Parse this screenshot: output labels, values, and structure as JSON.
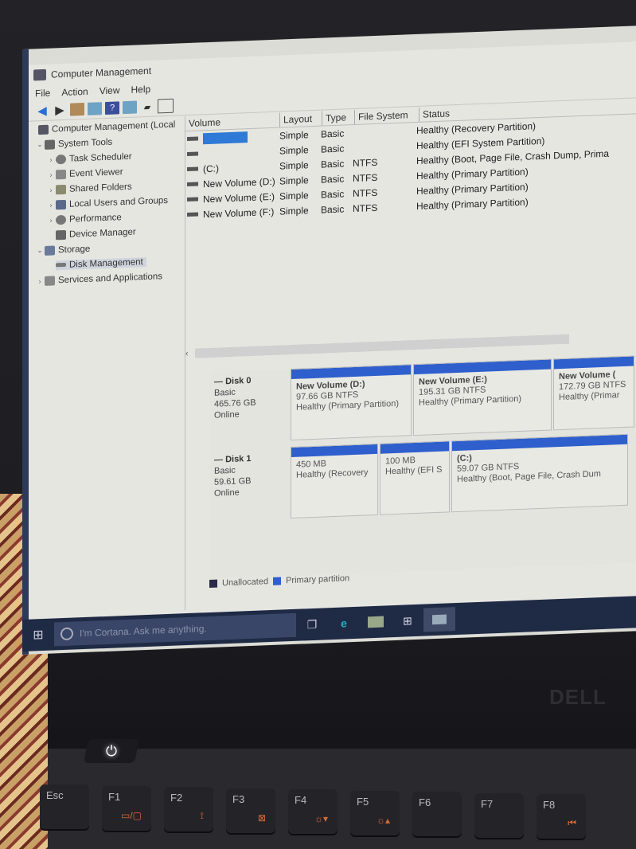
{
  "window": {
    "title": "Computer Management",
    "menu": [
      "File",
      "Action",
      "View",
      "Help"
    ],
    "toolbar_icons": [
      "back-arrow-icon",
      "forward-arrow-icon",
      "up-folder-icon",
      "show-hide-tree-icon",
      "help-icon",
      "properties-icon",
      "comment-icon",
      "list-icon"
    ]
  },
  "tree": {
    "root": "Computer Management (Local",
    "items": [
      {
        "label": "System Tools",
        "level": 1,
        "expanded": true
      },
      {
        "label": "Task Scheduler",
        "level": 2
      },
      {
        "label": "Event Viewer",
        "level": 2
      },
      {
        "label": "Shared Folders",
        "level": 2
      },
      {
        "label": "Local Users and Groups",
        "level": 2
      },
      {
        "label": "Performance",
        "level": 2
      },
      {
        "label": "Device Manager",
        "level": 2
      },
      {
        "label": "Storage",
        "level": 1,
        "expanded": true
      },
      {
        "label": "Disk Management",
        "level": 2,
        "selected": true
      },
      {
        "label": "Services and Applications",
        "level": 1
      }
    ]
  },
  "volume_table": {
    "headers": [
      "Volume",
      "Layout",
      "Type",
      "File System",
      "Status"
    ],
    "rows": [
      {
        "volume": "",
        "layout": "Simple",
        "type": "Basic",
        "fs": "",
        "status": "Healthy (Recovery Partition)"
      },
      {
        "volume": "",
        "layout": "Simple",
        "type": "Basic",
        "fs": "",
        "status": "Healthy (EFI System Partition)"
      },
      {
        "volume": "(C:)",
        "layout": "Simple",
        "type": "Basic",
        "fs": "NTFS",
        "status": "Healthy (Boot, Page File, Crash Dump, Prima"
      },
      {
        "volume": "New Volume (D:)",
        "layout": "Simple",
        "type": "Basic",
        "fs": "NTFS",
        "status": "Healthy (Primary Partition)"
      },
      {
        "volume": "New Volume (E:)",
        "layout": "Simple",
        "type": "Basic",
        "fs": "NTFS",
        "status": "Healthy (Primary Partition)"
      },
      {
        "volume": "New Volume (F:)",
        "layout": "Simple",
        "type": "Basic",
        "fs": "NTFS",
        "status": "Healthy (Primary Partition)"
      }
    ]
  },
  "disks": [
    {
      "name": "Disk 0",
      "type": "Basic",
      "size": "465.76 GB",
      "state": "Online",
      "partitions": [
        {
          "name": "New Volume (D:)",
          "size": "97.66 GB NTFS",
          "status": "Healthy (Primary Partition)"
        },
        {
          "name": "New Volume (E:)",
          "size": "195.31 GB NTFS",
          "status": "Healthy (Primary Partition)"
        },
        {
          "name": "New Volume (",
          "size": "172.79 GB NTFS",
          "status": "Healthy (Primar"
        }
      ]
    },
    {
      "name": "Disk 1",
      "type": "Basic",
      "size": "59.61 GB",
      "state": "Online",
      "partitions": [
        {
          "name": "",
          "size": "450 MB",
          "status": "Healthy (Recovery"
        },
        {
          "name": "",
          "size": "100 MB",
          "status": "Healthy (EFI S"
        },
        {
          "name": "(C:)",
          "size": "59.07 GB NTFS",
          "status": "Healthy (Boot, Page File, Crash Dum"
        }
      ]
    }
  ],
  "legend": [
    {
      "label": "Unallocated",
      "color": "#2b2b4a"
    },
    {
      "label": "Primary partition",
      "color": "#2e5fcc"
    }
  ],
  "taskbar": {
    "search_placeholder": "I'm Cortana. Ask me anything.",
    "icons": [
      "task-view-icon",
      "edge-icon",
      "file-explorer-icon",
      "store-icon",
      "computer-management-icon"
    ]
  },
  "laptop": {
    "brand": "DELL",
    "keys": [
      {
        "label": "Esc",
        "fn": ""
      },
      {
        "label": "F1",
        "fn": "▭/▢"
      },
      {
        "label": "F2",
        "fn": "⟟"
      },
      {
        "label": "F3",
        "fn": "⊠"
      },
      {
        "label": "F4",
        "fn": "☼▾"
      },
      {
        "label": "F5",
        "fn": "☼▴"
      },
      {
        "label": "F6",
        "fn": ""
      },
      {
        "label": "F7",
        "fn": ""
      },
      {
        "label": "F8",
        "fn": "⏮"
      }
    ]
  },
  "colors": {
    "accent": "#2e5fcc",
    "taskbar": "#1f2a44"
  }
}
